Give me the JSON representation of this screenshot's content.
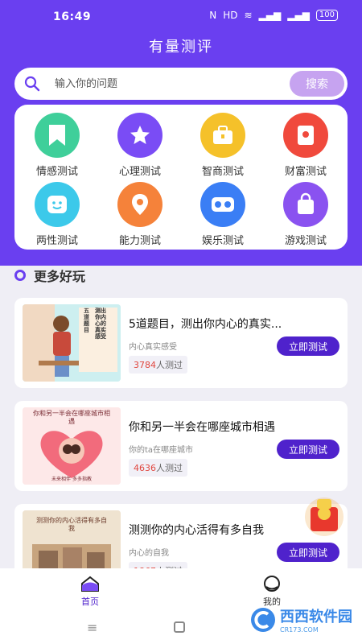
{
  "status": {
    "time": "16:49",
    "battery": "100"
  },
  "app_title": "有量测评",
  "search": {
    "placeholder": "输入你的问题",
    "button": "搜索"
  },
  "categories": [
    {
      "label": "情感测试",
      "icon": "bookmark-icon",
      "color": "#3fcf9a"
    },
    {
      "label": "心理测试",
      "icon": "star-icon",
      "color": "#7a4cf5"
    },
    {
      "label": "智商测试",
      "icon": "briefcase-icon",
      "color": "#f5c12a"
    },
    {
      "label": "财富测试",
      "icon": "red-envelope-icon",
      "color": "#f0493c"
    },
    {
      "label": "两性测试",
      "icon": "smile-icon",
      "color": "#3cc9ea"
    },
    {
      "label": "能力测试",
      "icon": "location-pin-icon",
      "color": "#f5823a"
    },
    {
      "label": "娱乐测试",
      "icon": "vr-glasses-icon",
      "color": "#3a7ef5"
    },
    {
      "label": "游戏测试",
      "icon": "shopping-bag-icon",
      "color": "#8a52f0"
    }
  ],
  "section_title": "更多好玩",
  "cards": [
    {
      "title": "5道题目，测出你内心的真实...",
      "subtitle": "内心真实感受",
      "count": "3784",
      "count_unit": "人测过",
      "button": "立即测试",
      "thumb_text": "测出你内心的真实感受",
      "thumb_text2": "五道题目"
    },
    {
      "title": "你和另一半会在哪座城市相遇",
      "subtitle": "你的ta在哪座城市",
      "count": "4636",
      "count_unit": "人测过",
      "button": "立即测试",
      "thumb_text": "你和另一半会在哪座城市相遇",
      "thumb_text2": "未来相伴 多多指教"
    },
    {
      "title": "测测你的内心活得有多自我",
      "subtitle": "内心的自我",
      "count": "1867",
      "count_unit": "人测过",
      "button": "立即测试",
      "thumb_text": "测测你的内心活得有多自我",
      "thumb_text2": "内心的自我"
    }
  ],
  "tabs": [
    {
      "label": "首页",
      "icon": "home-icon",
      "active": true
    },
    {
      "label": "我的",
      "icon": "profile-icon",
      "active": false
    }
  ],
  "watermark": {
    "text": "西西软件园",
    "sub": "CR173.COM"
  },
  "colors": {
    "primary": "#6a3ff0",
    "button": "#4f22cc",
    "count": "#e0473f"
  }
}
